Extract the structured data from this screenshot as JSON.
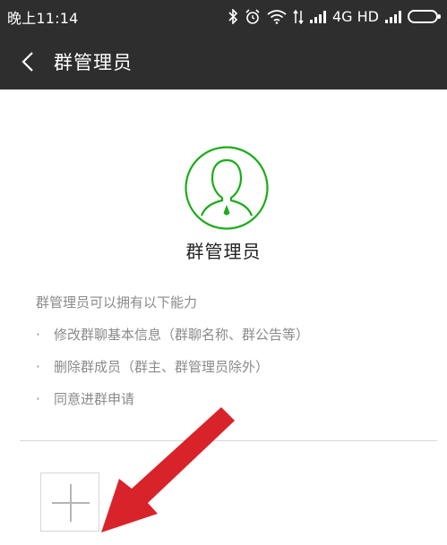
{
  "status_bar": {
    "time": "晚上11:14",
    "network": "4G HD",
    "icons": [
      "bluetooth-icon",
      "alarm-icon",
      "wifi-icon",
      "data-transfer-icon",
      "signal-icon",
      "signal-icon",
      "battery-icon"
    ]
  },
  "header": {
    "back_icon": "chevron-left-icon",
    "title": "群管理员"
  },
  "role": {
    "icon": "admin-avatar-icon",
    "accent_color": "#1aad19",
    "title": "群管理员"
  },
  "description": {
    "intro": "群管理员可以拥有以下能力",
    "bullet": "·",
    "items": [
      "修改群聊基本信息（群聊名称、群公告等）",
      "删除群成员（群主、群管理员除外）",
      "同意进群申请"
    ]
  },
  "add_button": {
    "icon": "plus-icon"
  },
  "annotation": {
    "icon": "red-arrow-icon",
    "color": "#d9232a"
  },
  "colors": {
    "header_bg": "#2e2e2e",
    "page_bg": "#ffffff",
    "text_secondary": "#8a8a8a"
  }
}
